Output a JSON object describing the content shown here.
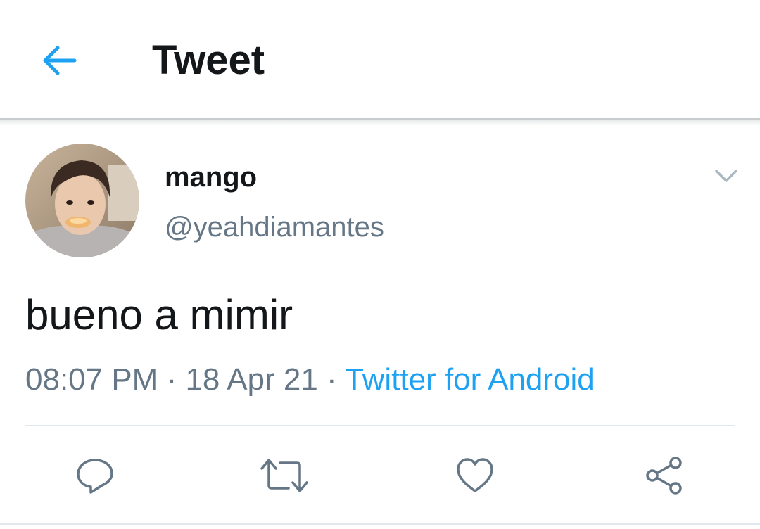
{
  "header": {
    "title": "Tweet",
    "back_icon": "arrow-left-icon"
  },
  "tweet": {
    "author_name": "mango",
    "author_handle": "@yeahdiamantes",
    "text": "bueno a mimir",
    "time": "08:07 PM",
    "separator": " · ",
    "date": "18 Apr 21",
    "source": "Twitter for Android",
    "more_icon": "chevron-down-icon"
  },
  "actions": [
    {
      "icon": "reply-icon"
    },
    {
      "icon": "retweet-icon"
    },
    {
      "icon": "like-icon"
    },
    {
      "icon": "share-icon"
    }
  ],
  "colors": {
    "accent": "#1da1f2",
    "text_primary": "#14171a",
    "text_secondary": "#657786",
    "divider": "#e1e8ed"
  }
}
